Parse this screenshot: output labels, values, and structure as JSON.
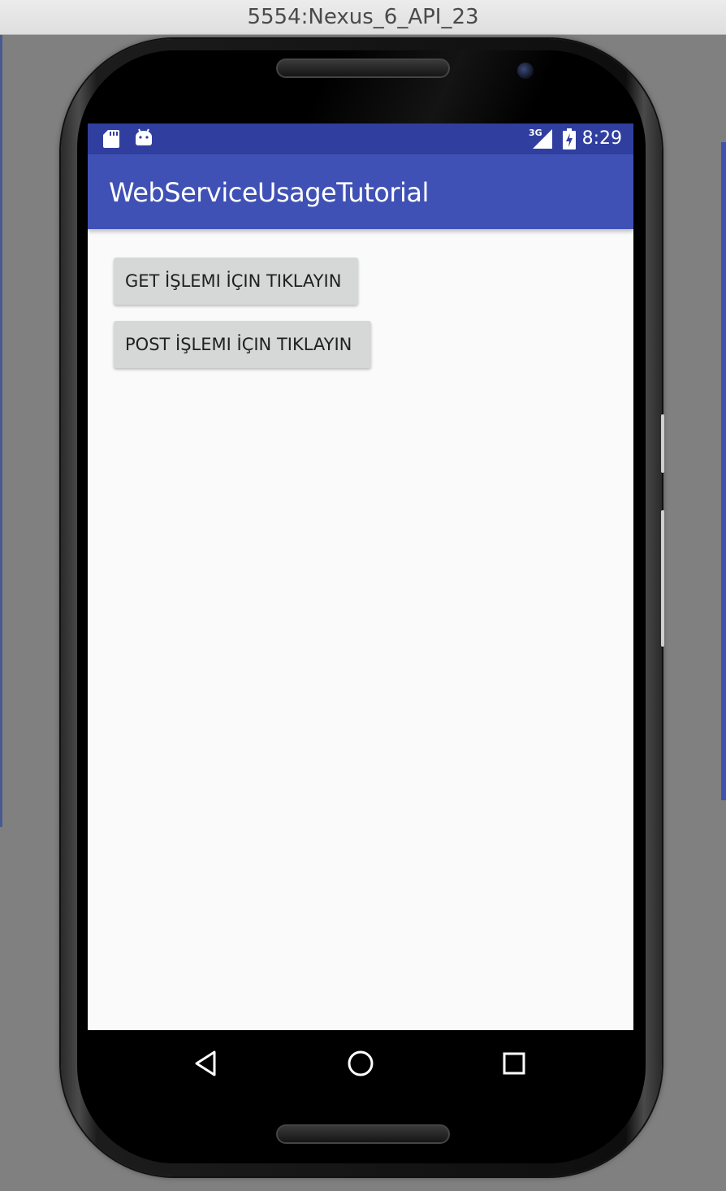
{
  "window": {
    "title": "5554:Nexus_6_API_23"
  },
  "status_bar": {
    "network": "3G",
    "time": "8:29",
    "icons": [
      "sd-card-icon",
      "android-debug-icon",
      "signal-icon",
      "battery-icon"
    ]
  },
  "app_bar": {
    "title": "WebServiceUsageTutorial"
  },
  "main": {
    "get_button": "GET İŞLEMI İÇIN TIKLAYIN",
    "post_button": "POST İŞLEMI İÇIN TIKLAYIN"
  },
  "nav_bar": {
    "icons": [
      "back-icon",
      "home-icon",
      "recents-icon"
    ]
  },
  "colors": {
    "status_bar": "#303f9f",
    "app_bar": "#3f51b5",
    "button_bg": "#d6d7d7",
    "screen_bg": "#fafafa"
  }
}
